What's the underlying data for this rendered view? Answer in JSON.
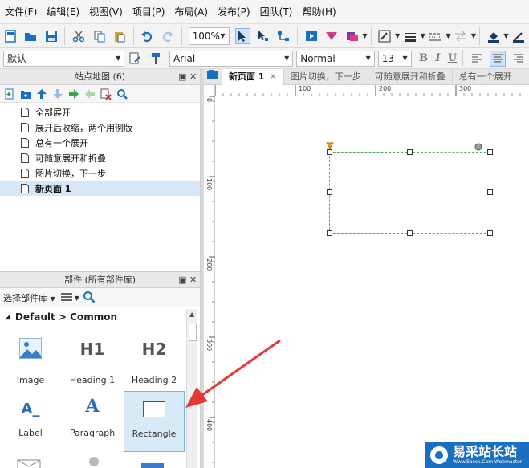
{
  "menubar": {
    "items": [
      "文件(F)",
      "编辑(E)",
      "视图(V)",
      "项目(P)",
      "布局(A)",
      "发布(P)",
      "团队(T)",
      "帮助(H)"
    ]
  },
  "toolbar": {
    "zoom": "100%"
  },
  "formatbar": {
    "style": "默认",
    "font": "Arial",
    "weight": "Normal",
    "size": "13",
    "bold": "B",
    "italic": "I",
    "underline": "U"
  },
  "sitemap": {
    "title": "站点地图 (6)",
    "pages": [
      {
        "label": "全部展开"
      },
      {
        "label": "展开后收缩，两个用例版"
      },
      {
        "label": "总有一个展开"
      },
      {
        "label": "可随意展开和折叠"
      },
      {
        "label": "图片切换，下一步"
      },
      {
        "label": "新页面 1"
      }
    ]
  },
  "widgets": {
    "title": "部件 (所有部件库)",
    "library_select": "选择部件库",
    "group": "Default > Common",
    "items": [
      {
        "label": "Image",
        "icon": "image-icon"
      },
      {
        "label": "Heading 1",
        "icon_text": "H1"
      },
      {
        "label": "Heading 2",
        "icon_text": "H2"
      },
      {
        "label": "Label",
        "icon_text": "A_"
      },
      {
        "label": "Paragraph",
        "icon_text": "A"
      },
      {
        "label": "Rectangle",
        "icon": "rectangle-icon"
      }
    ]
  },
  "tabs": [
    {
      "label": "新页面 1",
      "close": "✕"
    },
    {
      "label": "图片切换，下一步"
    },
    {
      "label": "可随意展开和折叠"
    },
    {
      "label": "总有一个展开"
    }
  ],
  "ruler": {
    "h_ticks": [
      "0",
      "100",
      "200",
      "300"
    ],
    "v_ticks": [
      "0",
      "100",
      "200",
      "300",
      "400"
    ]
  },
  "watermark": {
    "text": "易采站长站",
    "sub": "Www.Easck.Com Webmaster"
  },
  "colors": {
    "accent": "#1a6fc0",
    "selection": "#d6e8f7",
    "shape_border": "#4caf50",
    "arrow": "#e53935"
  }
}
